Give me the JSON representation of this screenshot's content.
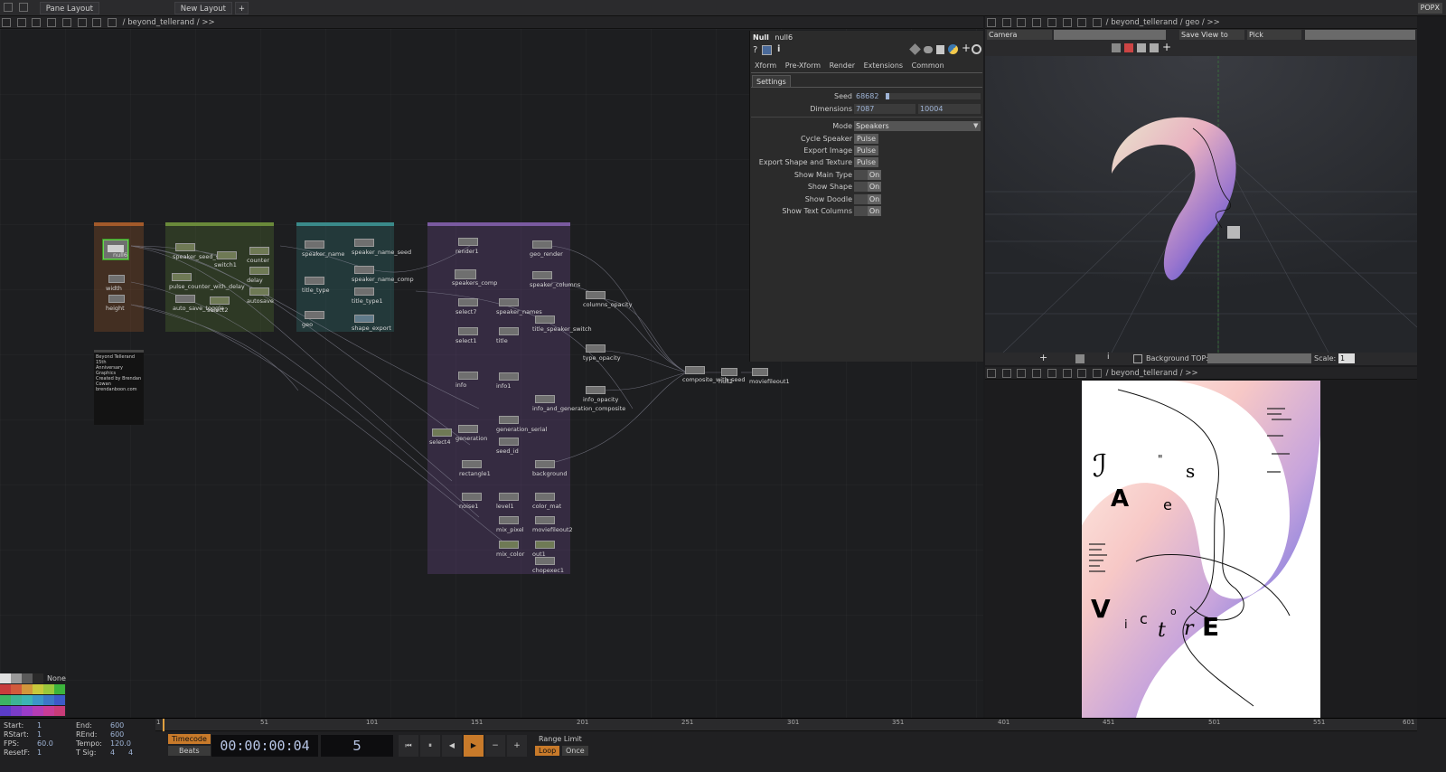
{
  "topbar": {
    "pane_layout": "Pane Layout",
    "new_layout": "New Layout",
    "add": "+",
    "brand": "POPX"
  },
  "network": {
    "path": "/ beyond_tellerand / >>",
    "desc_lines": [
      "Beyond Tellerand 15th",
      "Anniversary Graphics",
      "Created by Brendan",
      "Cowan",
      "brendanboon.com"
    ],
    "nodes": [
      {
        "label": "null6"
      },
      {
        "label": "width"
      },
      {
        "label": "height"
      },
      {
        "label": "speaker_seed_select"
      },
      {
        "label": "switch1"
      },
      {
        "label": "counter"
      },
      {
        "label": "pulse_counter_with_delay"
      },
      {
        "label": "delay"
      },
      {
        "label": "autosave"
      },
      {
        "label": "auto_save_toggle"
      },
      {
        "label": "select2"
      },
      {
        "label": "speaker_name"
      },
      {
        "label": "speaker_name_seed"
      },
      {
        "label": "speaker_name_comp"
      },
      {
        "label": "title_type"
      },
      {
        "label": "title_type1"
      },
      {
        "label": "geo"
      },
      {
        "label": "shape_export"
      },
      {
        "label": "render1"
      },
      {
        "label": "geo_render"
      },
      {
        "label": "speakers_comp"
      },
      {
        "label": "speaker_columns"
      },
      {
        "label": "columns_opacity"
      },
      {
        "label": "select7"
      },
      {
        "label": "speaker_names"
      },
      {
        "label": "title_speaker_switch"
      },
      {
        "label": "select1"
      },
      {
        "label": "title"
      },
      {
        "label": "type_opacity"
      },
      {
        "label": "info"
      },
      {
        "label": "info1"
      },
      {
        "label": "info_opacity"
      },
      {
        "label": "info_and_generation_composite"
      },
      {
        "label": "generation_serial"
      },
      {
        "label": "select4"
      },
      {
        "label": "generation"
      },
      {
        "label": "seed_id"
      },
      {
        "label": "rectangle1"
      },
      {
        "label": "background"
      },
      {
        "label": "noise1"
      },
      {
        "label": "level1"
      },
      {
        "label": "color_mat"
      },
      {
        "label": "mix_pixel"
      },
      {
        "label": "moviefileout2"
      },
      {
        "label": "mix_color"
      },
      {
        "label": "out1"
      },
      {
        "label": "chopexec1"
      },
      {
        "label": "composite_with_seed"
      },
      {
        "label": "null1"
      },
      {
        "label": "moviefileout1"
      }
    ]
  },
  "params": {
    "op_type": "Null",
    "op_name": "null6",
    "tabs": [
      "Xform",
      "Pre-Xform",
      "Render",
      "Extensions",
      "Common"
    ],
    "page_tab": "Settings",
    "seed": {
      "label": "Seed",
      "value": "68682"
    },
    "dimensions": {
      "label": "Dimensions",
      "w": "7087",
      "h": "10004"
    },
    "mode": {
      "label": "Mode",
      "value": "Speakers"
    },
    "pulses": [
      {
        "label": "Cycle Speaker",
        "btn": "Pulse"
      },
      {
        "label": "Export Image",
        "btn": "Pulse"
      },
      {
        "label": "Export Shape and Texture",
        "btn": "Pulse"
      }
    ],
    "toggles": [
      {
        "label": "Show Main Type",
        "state": "On"
      },
      {
        "label": "Show Shape",
        "state": "On"
      },
      {
        "label": "Show Doodle",
        "state": "On"
      },
      {
        "label": "Show Text Columns",
        "state": "On"
      }
    ]
  },
  "viewer3d": {
    "path": "/ beyond_tellerand / geo / >>",
    "camera": "Camera",
    "save_view": "Save View to",
    "pick": "Pick",
    "bg_top_label": "Background TOP:",
    "scale_label": "Scale:",
    "scale_value": "1"
  },
  "viewer2d": {
    "path": "/ beyond_tellerand / >>",
    "poster_letters": [
      "ℐ",
      "\"",
      "s",
      "A",
      "e",
      "V",
      "i",
      "c",
      "t",
      "o",
      "r",
      "E"
    ]
  },
  "palette": {
    "none_label": "None",
    "colors": [
      "#e0e0e0",
      "#9a9a9a",
      "#5a5a5a",
      "#2a2a2a",
      "#c83c3c",
      "#d25a3c",
      "#d2963c",
      "#c8c83c",
      "#3cb43c",
      "#3cb496",
      "#3c96c8",
      "#3c5ac8",
      "#7a3cc8",
      "#b43cb4",
      "#c83c78",
      "#8a5a3c"
    ]
  },
  "timeline": {
    "start_label": "Start:",
    "start": "1",
    "rstart_label": "RStart:",
    "rstart": "1",
    "fps_label": "FPS:",
    "fps": "60.0",
    "resetf_label": "ResetF:",
    "resetf": "1",
    "end_label": "End:",
    "end": "600",
    "rend_label": "REnd:",
    "rend": "600",
    "tempo_label": "Tempo:",
    "tempo": "120.0",
    "tsig_label": "T Sig:",
    "tsig_a": "4",
    "tsig_b": "4",
    "timecode_btn": "Timecode",
    "beats_btn": "Beats",
    "timecode": "00:00:00:04",
    "frame": "5",
    "range_limit": "Range Limit",
    "loop": "Loop",
    "once": "Once",
    "ticks": [
      "1",
      "51",
      "101",
      "151",
      "201",
      "251",
      "301",
      "351",
      "401",
      "451",
      "501",
      "551",
      "601"
    ]
  }
}
